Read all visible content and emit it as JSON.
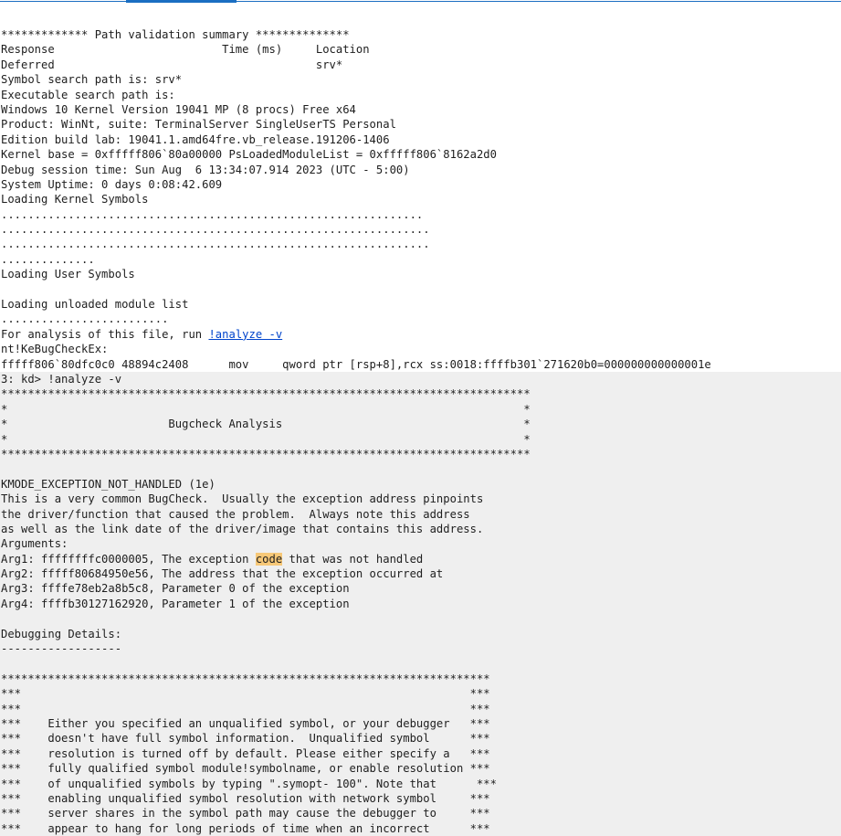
{
  "output": {
    "plain_lines": [
      "************* Path validation summary **************",
      "Response                         Time (ms)     Location",
      "Deferred                                       srv*",
      "Symbol search path is: srv*",
      "Executable search path is:",
      "Windows 10 Kernel Version 19041 MP (8 procs) Free x64",
      "Product: WinNt, suite: TerminalServer SingleUserTS Personal",
      "Edition build lab: 19041.1.amd64fre.vb_release.191206-1406",
      "Kernel base = 0xfffff806`80a00000 PsLoadedModuleList = 0xfffff806`8162a2d0",
      "Debug session time: Sun Aug  6 13:34:07.914 2023 (UTC - 5:00)",
      "System Uptime: 0 days 0:08:42.609",
      "Loading Kernel Symbols",
      "...............................................................",
      "................................................................",
      "................................................................",
      "..............",
      "Loading User Symbols",
      "",
      "Loading unloaded module list",
      "........................."
    ],
    "analysis_prompt": {
      "prefix": "For analysis of this file, run ",
      "link": "!analyze -v"
    },
    "fault_symbol": "nt!KeBugCheckEx:",
    "fault_instruction": "fffff806`80dfc0c0 48894c2408      mov     qword ptr [rsp+8],rcx ss:0018:ffffb301`271620b0=000000000000001e",
    "command_lines": [
      "3: kd> !analyze -v",
      "*******************************************************************************",
      "*                                                                             *",
      "*                        Bugcheck Analysis                                    *",
      "*                                                                             *",
      "*******************************************************************************",
      "",
      "KMODE_EXCEPTION_NOT_HANDLED (1e)",
      "This is a very common BugCheck.  Usually the exception address pinpoints",
      "the driver/function that caused the problem.  Always note this address",
      "as well as the link date of the driver/image that contains this address.",
      "Arguments:"
    ],
    "arg1": {
      "before": "Arg1: ffffffffc0000005, The exception ",
      "highlight": "code",
      "after": " that was not handled"
    },
    "tail_lines": [
      "Arg2: fffff80684950e56, The address that the exception occurred at",
      "Arg3: ffffe78eb2a8b5c8, Parameter 0 of the exception",
      "Arg4: ffffb30127162920, Parameter 1 of the exception",
      "",
      "Debugging Details:",
      "------------------",
      "",
      "*************************************************************************",
      "***                                                                   ***",
      "***                                                                   ***",
      "***    Either you specified an unqualified symbol, or your debugger   ***",
      "***    doesn't have full symbol information.  Unqualified symbol      ***",
      "***    resolution is turned off by default. Please either specify a   ***",
      "***    fully qualified symbol module!symbolname, or enable resolution ***",
      "***    of unqualified symbols by typing \".symopt- 100\". Note that      ***",
      "***    enabling unqualified symbol resolution with network symbol     ***",
      "***    server shares in the symbol path may cause the debugger to     ***",
      "***    appear to hang for long periods of time when an incorrect      ***"
    ]
  }
}
